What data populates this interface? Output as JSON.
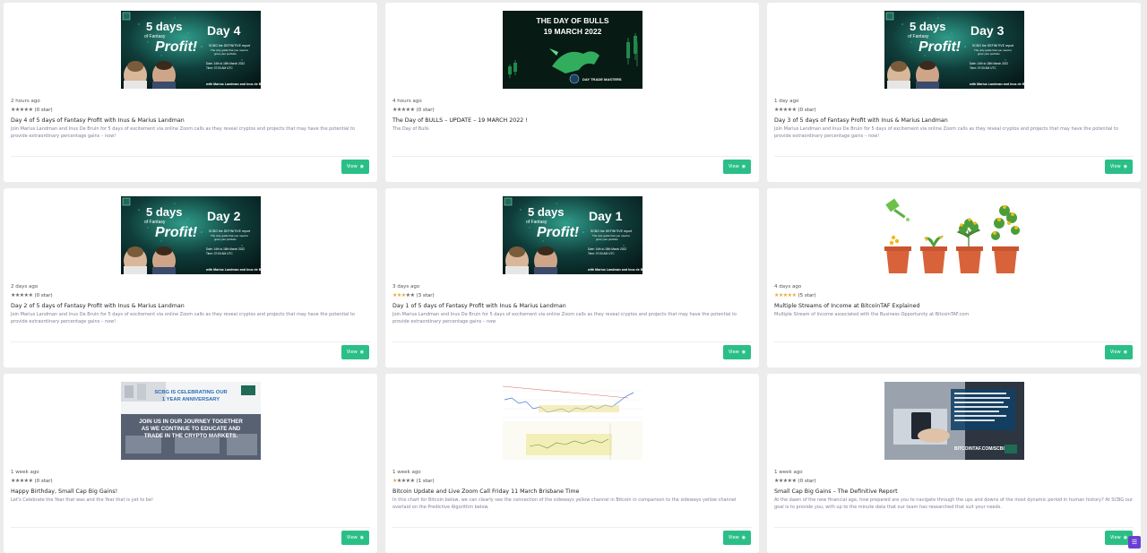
{
  "cards": [
    {
      "time": "2 hours ago",
      "rating": "(0 star)",
      "stars_filled": 0,
      "title": "Day 4 of 5 days of Fantasy Profit with Inus & Marius Landman",
      "desc": "Join Marius Landman and Inus De Bruin for 5 days of excitement via online Zoom calls as they reveal cryptos and projects that may have the potential to provide extraordinary percentage gains – now!",
      "view_label": "View",
      "thumb": {
        "kind": "fantasy",
        "day": "Day 4"
      }
    },
    {
      "time": "4 hours ago",
      "rating": "(0 star)",
      "stars_filled": 0,
      "title": "The Day of BULLS – UPDATE – 19 MARCH 2022 !",
      "desc": "The Day of Bulls",
      "view_label": "View",
      "thumb": {
        "kind": "bulls",
        "line1": "THE DAY OF BULLS",
        "line2": "19 MARCH 2022",
        "brand": "DAY TRADE MASTERS"
      }
    },
    {
      "time": "1 day ago",
      "rating": "(0 star)",
      "stars_filled": 0,
      "title": "Day 3 of 5 days of Fantasy Profit with Inus & Marius Landman",
      "desc": "Join Marius Landman and Inus De Bruin for 5 days of excitement via online Zoom calls as they reveal cryptos and projects that may have the potential to provide extraordinary percentage gains – now!",
      "view_label": "View",
      "thumb": {
        "kind": "fantasy",
        "day": "Day 3"
      }
    },
    {
      "time": "2 days ago",
      "rating": "(0 star)",
      "stars_filled": 0,
      "title": "Day 2 of 5 days of Fantasy Profit with Inus & Marius Landman",
      "desc": "Join Marius Landman and Inus De Bruin for 5 days of excitement via online Zoom calls as they reveal cryptos and projects that may have the potential to provide extraordinary percentage gains – now!",
      "view_label": "View",
      "thumb": {
        "kind": "fantasy",
        "day": "Day 2"
      }
    },
    {
      "time": "3 days ago",
      "rating": "(3 star)",
      "stars_filled": 3,
      "title": "Day 1 of 5 days of Fantasy Profit with Inus & Marius Landman",
      "desc": "Join Marius Landman and Inus De Bruin for 5 days of excitement via online Zoom calls as they reveal cryptos and projects that may have the potential to provide extraordinary percentage gains – now",
      "view_label": "View",
      "thumb": {
        "kind": "fantasy",
        "day": "Day 1"
      }
    },
    {
      "time": "4 days ago",
      "rating": "(5 star)",
      "stars_filled": 5,
      "title": "Multiple Streams of Income at BitcoinTAF Explained",
      "desc": "Multiple Stream of Income associated with the Business Opportunity at BitcoinTAF.com",
      "view_label": "View",
      "thumb": {
        "kind": "plants"
      }
    },
    {
      "time": "1 week ago",
      "rating": "(0 star)",
      "stars_filled": 0,
      "title": "Happy Birthday, Small Cap Big Gains!",
      "desc": "Let's Celebrate the Year that was and the Year that is yet to be!",
      "view_label": "View",
      "thumb": {
        "kind": "anniversary",
        "line1": "SCBG IS CELEBRATING OUR",
        "line2": "1 YEAR ANNIVERSARY",
        "line3": "JOIN US IN OUR JOURNEY TOGETHER",
        "line4": "AS WE CONTINUE TO EDUCATE AND",
        "line5": "TRADE IN THE CRYPTO MARKETS."
      }
    },
    {
      "time": "1 week ago",
      "rating": "(1 star)",
      "stars_filled": 1,
      "title": "Bitcoin Update and Live Zoom Call Friday 11 March Brisbane Time",
      "desc": "In this chart for Bitcoin below, we can clearly see the connection of the sideways yellow channel in Bitcoin in comparison to the sideways yellow channel overlaid on the Predictive Algorithm below.",
      "view_label": "View",
      "thumb": {
        "kind": "chart"
      }
    },
    {
      "time": "1 week ago",
      "rating": "(0 star)",
      "stars_filled": 0,
      "title": "Small Cap Big Gains –  The Definitive Report",
      "desc": "At the dawn of the new financial age, how prepared are you to navigate through the ups and downs of the most dynamic period in human history? At SCBG our goal is to provide you, with up to the minute data that our team has researched that suit your needs.",
      "view_label": "View",
      "thumb": {
        "kind": "report",
        "url": "BITCOINTAF.COM/SCBG"
      }
    }
  ],
  "colors": {
    "accent": "#2bbf88",
    "chat": "#6b3fd6",
    "star_gold": "#e8a93a"
  },
  "chat_widget": {
    "icon": "chat-icon"
  }
}
